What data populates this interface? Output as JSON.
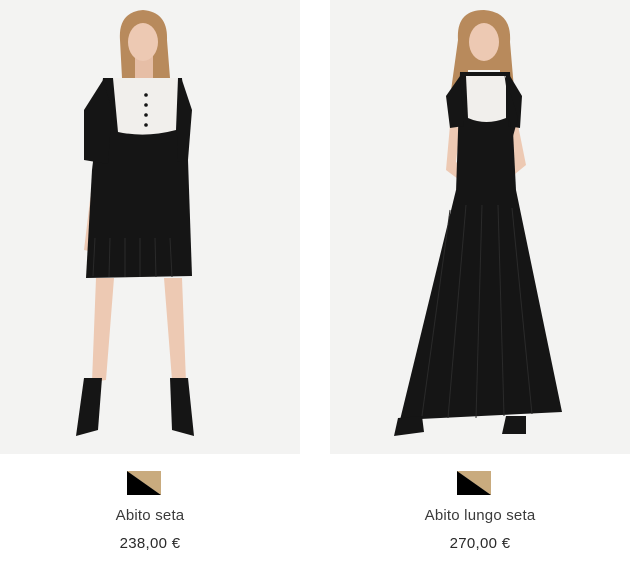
{
  "products": [
    {
      "name": "Abito seta",
      "price": "238,00 €",
      "image_icon": "short-black-dress-photo",
      "swatch_colors": [
        "#000000",
        "#c9ab7e"
      ]
    },
    {
      "name": "Abito lungo seta",
      "price": "270,00 €",
      "image_icon": "long-black-dress-photo",
      "swatch_colors": [
        "#000000",
        "#c9ab7e"
      ]
    }
  ],
  "colors": {
    "photo_background": "#f3f3f2",
    "dress": "#151515",
    "lace": "#f1efec",
    "skin": "#edc9b3",
    "hair": "#b88a5c"
  }
}
